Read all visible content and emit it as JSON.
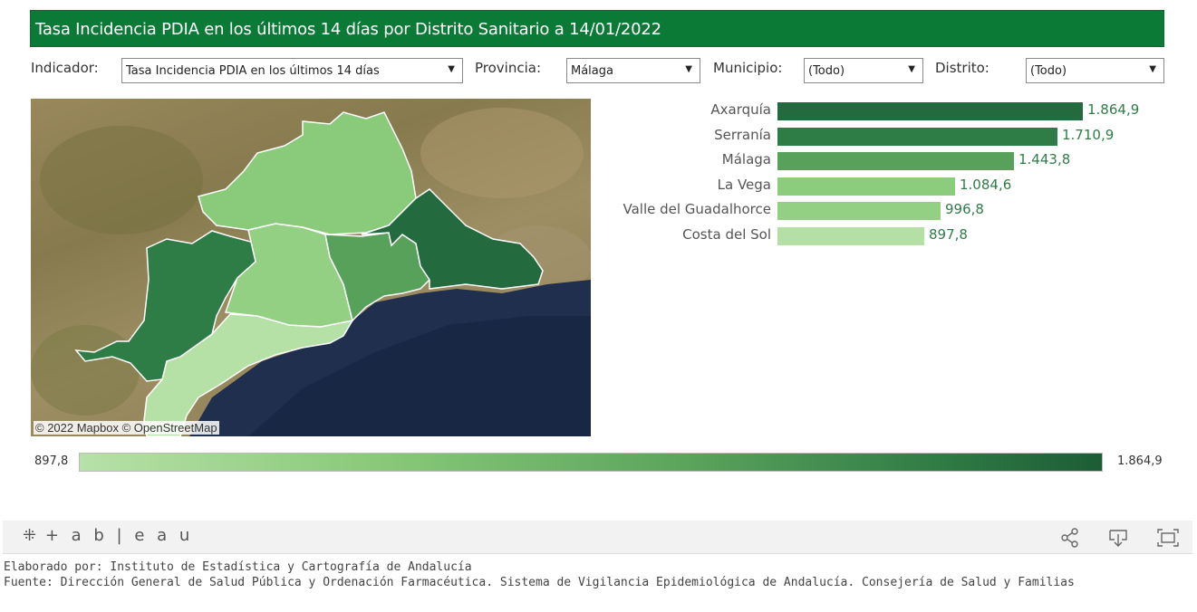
{
  "title": "Tasa Incidencia PDIA en los últimos 14 días por Distrito Sanitario a 14/01/2022",
  "filters": {
    "indicador_label": "Indicador:",
    "indicador_value": "Tasa Incidencia PDIA en los últimos 14 días",
    "provincia_label": "Provincia:",
    "provincia_value": "Málaga",
    "municipio_label": "Municipio:",
    "municipio_value": "(Todo)",
    "distrito_label": "Distrito:",
    "distrito_value": "(Todo)"
  },
  "map": {
    "attribution": "© 2022 Mapbox  © OpenStreetMap"
  },
  "chart_data": {
    "type": "bar",
    "categories": [
      "Axarquía",
      "Serranía",
      "Málaga",
      "La Vega",
      "Valle del Guadalhorce",
      "Costa del Sol"
    ],
    "values": [
      1864.9,
      1710.9,
      1443.8,
      1084.6,
      996.8,
      897.8
    ],
    "value_labels": [
      "1.864,9",
      "1.710,9",
      "1.443,8",
      "1.084,6",
      "996,8",
      "897,8"
    ],
    "colors": [
      "#236a3e",
      "#2e7d47",
      "#57a15a",
      "#8bcc7d",
      "#93d084",
      "#b4e0a5"
    ],
    "title": "",
    "xlabel": "",
    "ylabel": ""
  },
  "legend": {
    "min_label": "897,8",
    "max_label": "1.864,9"
  },
  "footer": {
    "logo": "+ a b | e a u",
    "credit1": "Elaborado por: Instituto de Estadística y Cartografía de Andalucía",
    "credit2": "Fuente: Dirección General de Salud Pública y Ordenación Farmacéutica. Sistema de Vigilancia Epidemiológica de Andalucía. Consejería de Salud y Familias"
  }
}
